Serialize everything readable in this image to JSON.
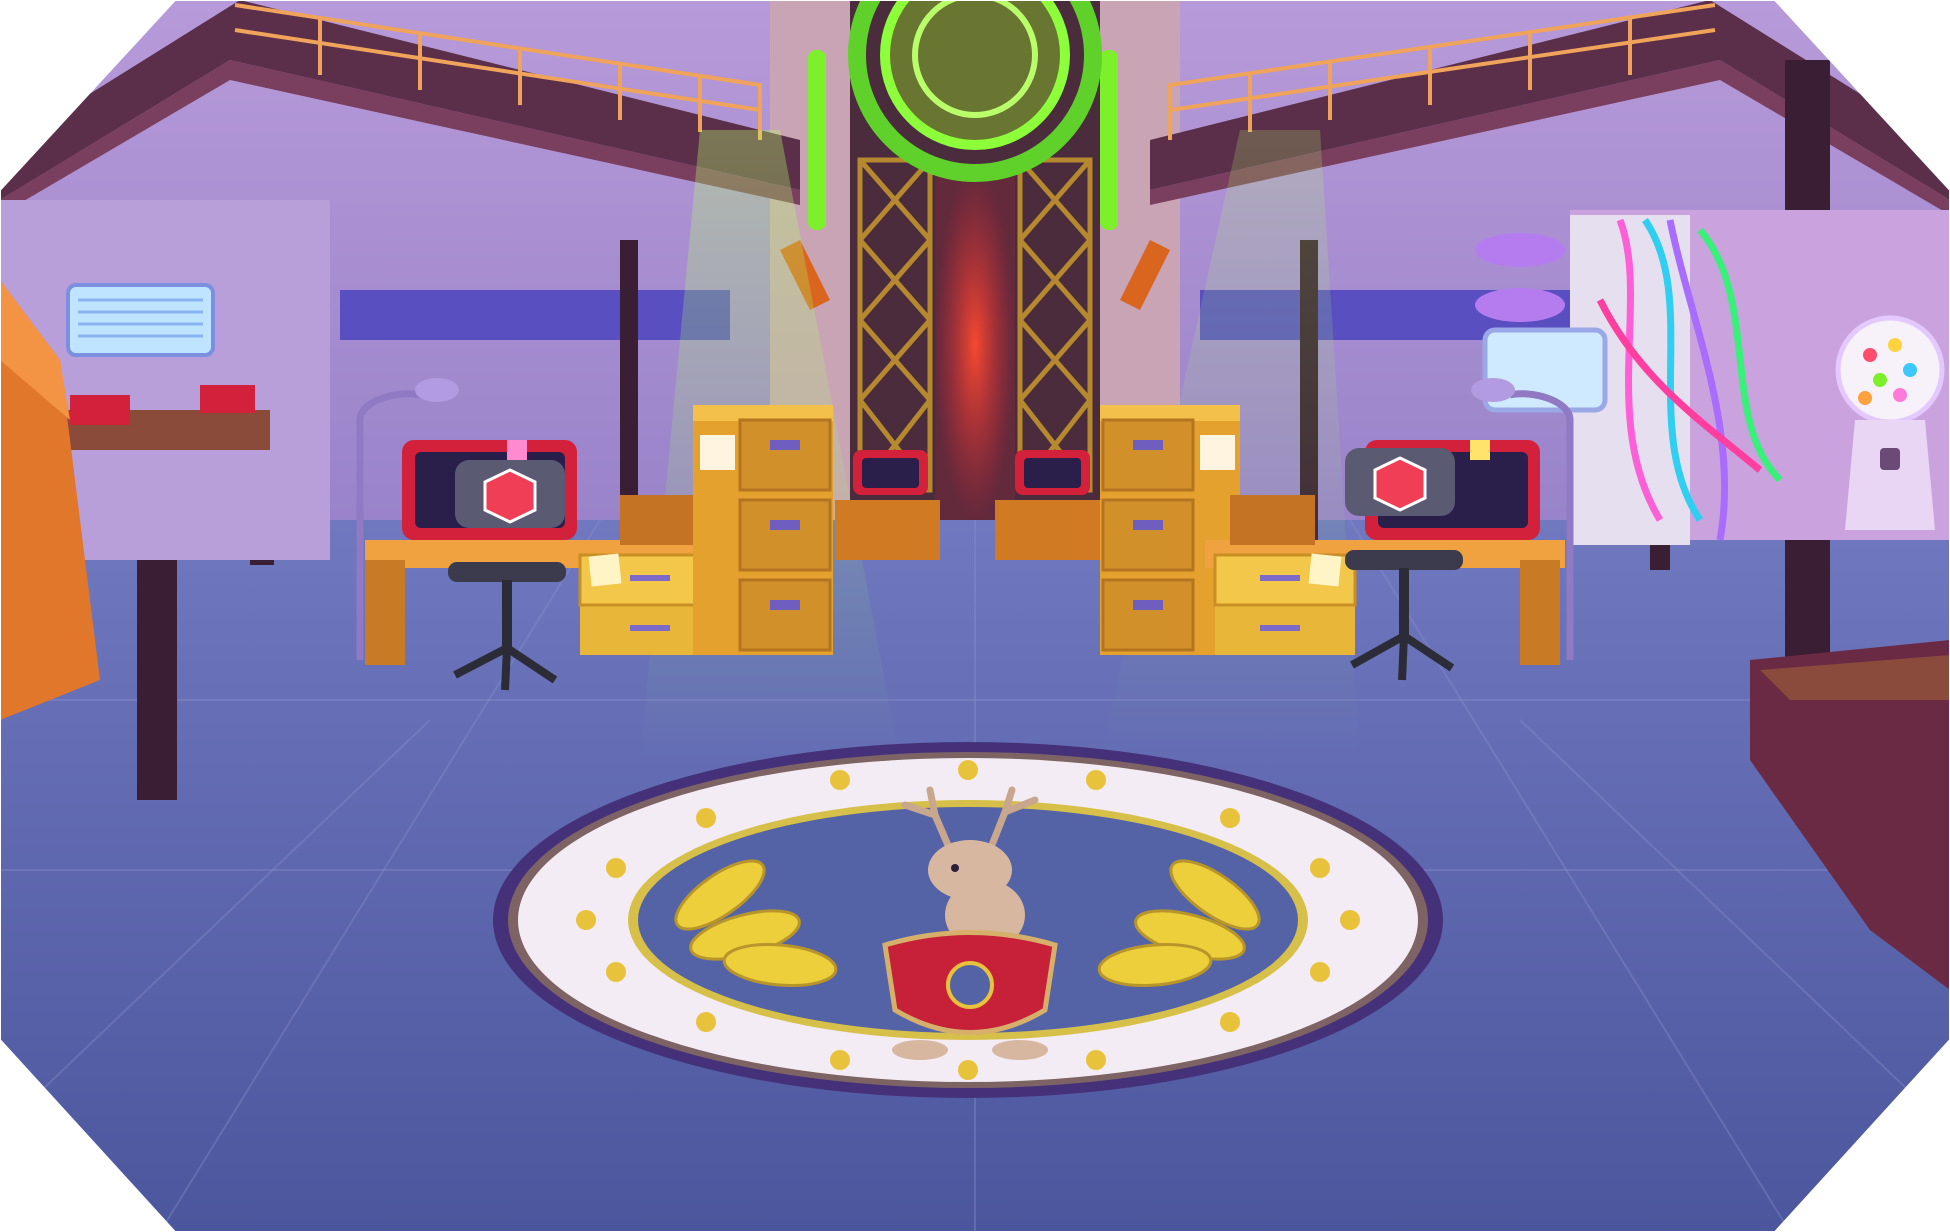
{
  "scene": {
    "kind": "game-background",
    "frame_shape": "octagon",
    "palette": {
      "wall": "#9c86c9",
      "wall_dark": "#6d5aa3",
      "floor": "#4f5aa1",
      "floor_light": "#6a6fb9",
      "catwalk": "#5b2f4a",
      "desk": "#e0962f",
      "cabinet": "#e4a12d",
      "monitor_frame": "#d4213b",
      "emblem_ring": "#45317a",
      "emblem_white": "#f3ecf5",
      "emblem_blue": "#5463a6",
      "star": "#e9c23c",
      "banana": "#eccf3a",
      "green_glow": "#7cf02b",
      "red_glow": "#ff3b2a",
      "gumball": "#ffffff"
    },
    "objects": [
      "catwalk-left",
      "catwalk-right",
      "central-tower",
      "green-ring",
      "filing-cabinet-left",
      "filing-cabinet-right",
      "desk-left",
      "desk-right",
      "office-chair-left",
      "office-chair-right",
      "floor-emblem",
      "jackalope-mascot",
      "gumball-machine",
      "cable-wall"
    ],
    "emblem": {
      "star_count": 16,
      "mascot": "jackalope",
      "laurels": "bananas"
    }
  }
}
